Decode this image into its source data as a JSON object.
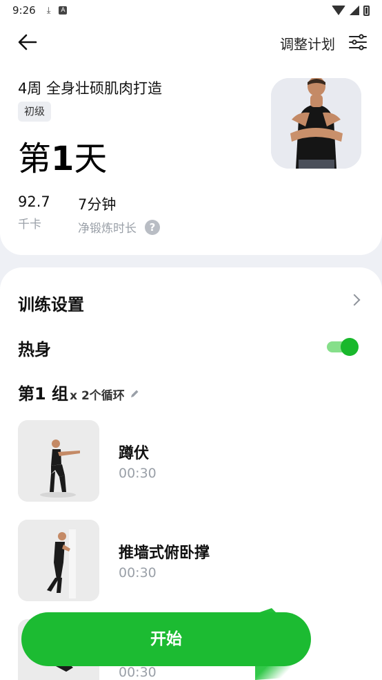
{
  "status_bar": {
    "time": "9:26"
  },
  "header": {
    "adjust_label": "调整计划"
  },
  "plan": {
    "title": "4周 全身壮硕肌肉打造",
    "level": "初级",
    "day_prefix": "第",
    "day_number": "1",
    "day_suffix": "天"
  },
  "stats": [
    {
      "value": "92.7",
      "label": "千卡"
    },
    {
      "value": "7分钟",
      "label": "净锻炼时长"
    }
  ],
  "settings": {
    "label": "训练设置"
  },
  "warmup": {
    "label": "热身",
    "enabled": true
  },
  "group": {
    "title": "第1 组",
    "cycles": "x 2个循环"
  },
  "exercises": [
    {
      "name": "蹲伏",
      "duration": "00:30"
    },
    {
      "name": "推墙式俯卧撑",
      "duration": "00:30"
    },
    {
      "name": "",
      "duration": "00:30"
    }
  ],
  "start_button": {
    "label": "开始"
  },
  "colors": {
    "accent": "#1cbb32",
    "toggle_track": "#86df8a",
    "secondary_text": "#9aa0a8"
  }
}
